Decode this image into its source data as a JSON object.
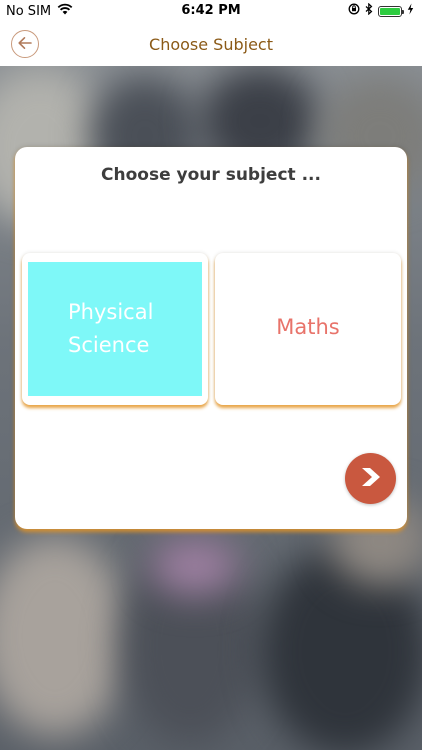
{
  "status_bar": {
    "carrier": "No SIM",
    "time": "6:42 PM",
    "icons": [
      "wifi-icon",
      "orientation-lock-icon",
      "bluetooth-icon",
      "battery-icon",
      "charging-icon"
    ],
    "battery_level": 1.0
  },
  "nav": {
    "title": "Choose Subject",
    "back_icon": "arrow-left-icon"
  },
  "card": {
    "title": "Choose your subject ...",
    "subjects": [
      {
        "label": "Physical Science",
        "selected": true
      },
      {
        "label": "Maths",
        "selected": false
      }
    ],
    "next_icon": "chevron-right-icon"
  },
  "colors": {
    "title_brown": "#8b5a17",
    "back_ring": "#c99a7c",
    "selected_tile": "#7ef8f8",
    "maths_text": "#e8736a",
    "next_button": "#c9583f",
    "tile_shadow": "#e69628"
  }
}
